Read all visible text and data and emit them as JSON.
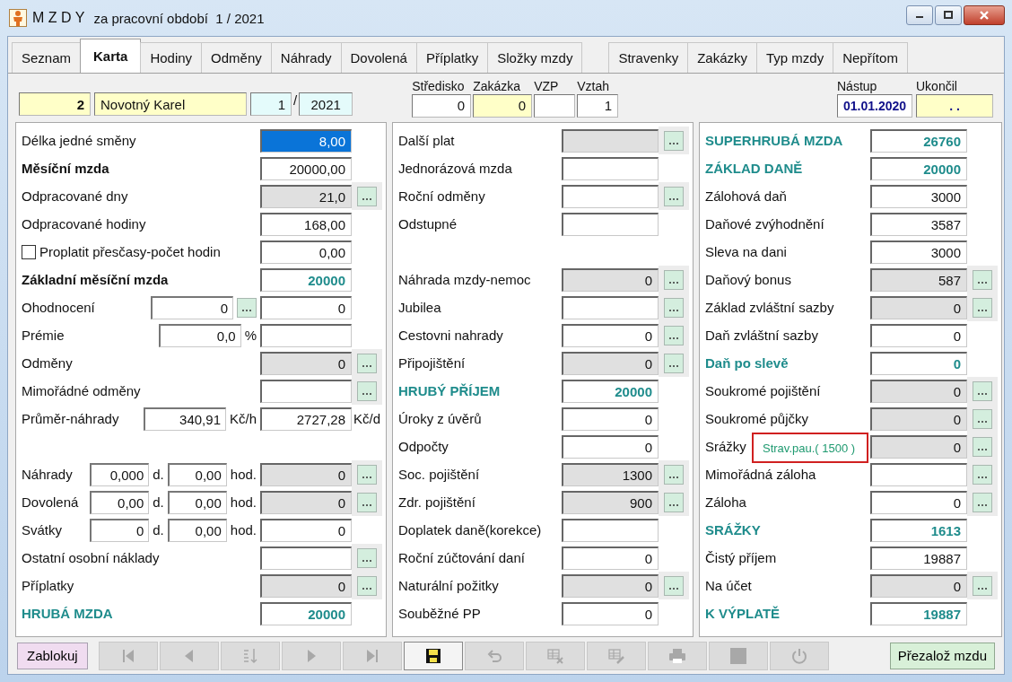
{
  "window": {
    "title": "M Z D Y",
    "subtitle": "za pracovní období  1 / 2021"
  },
  "tabs": [
    {
      "label": "Seznam",
      "selected": false
    },
    {
      "label": "Karta",
      "selected": true
    },
    {
      "label": "Hodiny",
      "selected": false
    },
    {
      "label": "Odměny",
      "selected": false
    },
    {
      "label": "Náhrady",
      "selected": false
    },
    {
      "label": "Dovolená",
      "selected": false
    },
    {
      "label": "Příplatky",
      "selected": false
    },
    {
      "label": "Složky mzdy",
      "selected": false
    },
    {
      "label": "Stravenky",
      "selected": false
    },
    {
      "label": "Zakázky",
      "selected": false
    },
    {
      "label": "Typ mzdy",
      "selected": false
    },
    {
      "label": "Nepřítom",
      "selected": false
    }
  ],
  "header": {
    "number": "2",
    "name": "Novotný Karel",
    "month": "1",
    "separator": "/",
    "year": "2021",
    "fields": [
      {
        "label": "Středisko",
        "value": "0",
        "highlighted": false
      },
      {
        "label": "Zakázka",
        "value": "0",
        "highlighted": true
      },
      {
        "label": "VZP",
        "highlighted": false
      },
      {
        "label": "Vztah",
        "value": "1",
        "highlighted": false
      }
    ],
    "dates": [
      {
        "label": "Nástup",
        "value": "01.01.2020",
        "highlighted": false
      },
      {
        "label": "Ukončil",
        "value": ". .",
        "highlighted": true
      }
    ]
  },
  "panels": [
    {
      "rows": [
        {
          "kind": "field",
          "label": "Délka jedné směny",
          "bold": false,
          "teal_label": false,
          "teal_value": false,
          "value": "8,00",
          "readonly": false,
          "more": false,
          "focused": true
        },
        {
          "kind": "field",
          "label": "Měsíční mzda",
          "bold": true,
          "teal_label": false,
          "teal_value": false,
          "value": "20000,00",
          "readonly": false,
          "more": false,
          "focused": false
        },
        {
          "kind": "field",
          "label": "Odpracované dny",
          "bold": false,
          "teal_label": false,
          "teal_value": false,
          "value": "21,0",
          "readonly": true,
          "more": true,
          "focused": false
        },
        {
          "kind": "field",
          "label": "Odpracované hodiny",
          "bold": false,
          "teal_label": false,
          "teal_value": false,
          "value": "168,00",
          "readonly": false,
          "more": false,
          "focused": false
        },
        {
          "kind": "check",
          "label": "Proplatit přesčasy-počet hodin",
          "checked": false,
          "bold": false,
          "teal_label": false,
          "teal_value": false,
          "value": "0,00",
          "readonly": false,
          "more": false,
          "focused": false
        },
        {
          "kind": "field",
          "label": "Základní měsíční mzda",
          "bold": true,
          "teal_label": false,
          "teal_value": true,
          "value": "20000",
          "readonly": false,
          "more": false,
          "focused": false
        },
        {
          "kind": "field",
          "label": "Ohodnocení",
          "bold": false,
          "teal_label": false,
          "teal_value": false,
          "inputs": [
            {
              "value": "0",
              "more": true
            }
          ],
          "value": "0",
          "readonly": false,
          "more": false,
          "focused": false
        },
        {
          "kind": "field",
          "label": "Prémie",
          "bold": false,
          "teal_label": false,
          "inputs": [
            {
              "value": "0,0",
              "unit": "%",
              "more": false
            }
          ],
          "readonly": false,
          "more": false,
          "focused": false
        },
        {
          "kind": "field",
          "label": "Odměny",
          "bold": false,
          "teal_label": false,
          "teal_value": false,
          "value": "0",
          "readonly": true,
          "more": true,
          "focused": false
        },
        {
          "kind": "field",
          "label": "Mimořádné odměny",
          "bold": false,
          "teal_label": false,
          "readonly": false,
          "more": true,
          "focused": false
        },
        {
          "kind": "field",
          "label": "Průměr-náhrady",
          "bold": false,
          "teal_label": false,
          "teal_value": false,
          "inputs": [
            {
              "value": "340,91",
              "unit": "Kč/h",
              "more": false
            }
          ],
          "value": "2727,28",
          "unit": "Kč/d",
          "readonly": false,
          "more": false,
          "focused": false
        },
        {
          "kind": "spacer"
        },
        {
          "kind": "field",
          "label": "Náhrady",
          "bold": false,
          "teal_label": false,
          "teal_value": false,
          "inputs": [
            {
              "value": "0,000",
              "unit": "d.",
              "more": false
            },
            {
              "value": "0,00",
              "unit": "hod.",
              "more": false
            }
          ],
          "value": "0",
          "readonly": true,
          "more": true,
          "focused": false
        },
        {
          "kind": "field",
          "label": "Dovolená",
          "bold": false,
          "teal_label": false,
          "teal_value": false,
          "inputs": [
            {
              "value": "0,00",
              "unit": "d.",
              "more": false
            },
            {
              "value": "0,00",
              "unit": "hod.",
              "more": false
            }
          ],
          "value": "0",
          "readonly": true,
          "more": true,
          "focused": false
        },
        {
          "kind": "field",
          "label": "Svátky",
          "bold": false,
          "teal_label": false,
          "teal_value": false,
          "inputs": [
            {
              "value": "0",
              "unit": "d.",
              "more": false
            },
            {
              "value": "0,00",
              "unit": "hod.",
              "more": false
            }
          ],
          "value": "0",
          "readonly": false,
          "more": false,
          "focused": false
        },
        {
          "kind": "field",
          "label": "Ostatní osobní náklady",
          "bold": false,
          "teal_label": false,
          "readonly": false,
          "more": true,
          "focused": false
        },
        {
          "kind": "field",
          "label": "Příplatky",
          "bold": false,
          "teal_label": false,
          "teal_value": false,
          "value": "0",
          "readonly": true,
          "more": true,
          "focused": false
        },
        {
          "kind": "field",
          "label": "HRUBÁ MZDA",
          "bold": true,
          "teal_label": true,
          "teal_value": true,
          "value": "20000",
          "readonly": false,
          "more": false,
          "focused": false
        }
      ]
    },
    {
      "rows": [
        {
          "kind": "field",
          "label": "Další plat",
          "bold": false,
          "teal_label": false,
          "readonly": true,
          "more": true,
          "focused": false
        },
        {
          "kind": "field",
          "label": "Jednorázová mzda",
          "bold": false,
          "teal_label": false,
          "readonly": false,
          "more": false,
          "focused": false
        },
        {
          "kind": "field",
          "label": "Roční odměny",
          "bold": false,
          "teal_label": false,
          "readonly": false,
          "more": true,
          "focused": false
        },
        {
          "kind": "field",
          "label": "Odstupné",
          "bold": false,
          "teal_label": false,
          "readonly": false,
          "more": false,
          "focused": false
        },
        {
          "kind": "spacer"
        },
        {
          "kind": "field",
          "label": "Náhrada mzdy-nemoc",
          "bold": false,
          "teal_label": false,
          "teal_value": false,
          "value": "0",
          "readonly": true,
          "more": true,
          "focused": false
        },
        {
          "kind": "field",
          "label": "Jubilea",
          "bold": false,
          "teal_label": false,
          "readonly": false,
          "more": true,
          "focused": false
        },
        {
          "kind": "field",
          "label": "Cestovni nahrady",
          "bold": false,
          "teal_label": false,
          "teal_value": false,
          "value": "0",
          "readonly": false,
          "more": true,
          "focused": false
        },
        {
          "kind": "field",
          "label": "Připojištění",
          "bold": false,
          "teal_label": false,
          "teal_value": false,
          "value": "0",
          "readonly": true,
          "more": true,
          "focused": false
        },
        {
          "kind": "field",
          "label": "HRUBÝ PŘÍJEM",
          "bold": true,
          "teal_label": true,
          "teal_value": true,
          "value": "20000",
          "readonly": false,
          "more": false,
          "focused": false
        },
        {
          "kind": "field",
          "label": "Úroky z úvěrů",
          "bold": false,
          "teal_label": false,
          "teal_value": false,
          "value": "0",
          "readonly": false,
          "more": false,
          "focused": false
        },
        {
          "kind": "field",
          "label": "Odpočty",
          "bold": false,
          "teal_label": false,
          "teal_value": false,
          "value": "0",
          "readonly": false,
          "more": false,
          "focused": false
        },
        {
          "kind": "field",
          "label": "Soc. pojištění",
          "bold": false,
          "teal_label": false,
          "teal_value": false,
          "value": "1300",
          "readonly": true,
          "more": true,
          "focused": false
        },
        {
          "kind": "field",
          "label": "Zdr. pojištění",
          "bold": false,
          "teal_label": false,
          "teal_value": false,
          "value": "900",
          "readonly": true,
          "more": true,
          "focused": false
        },
        {
          "kind": "field",
          "label": "Doplatek daně(korekce)",
          "bold": false,
          "teal_label": false,
          "readonly": false,
          "more": false,
          "focused": false
        },
        {
          "kind": "field",
          "label": "Roční zúčtování daní",
          "bold": false,
          "teal_label": false,
          "teal_value": false,
          "value": "0",
          "readonly": false,
          "more": false,
          "focused": false
        },
        {
          "kind": "field",
          "label": "Naturální požitky",
          "bold": false,
          "teal_label": false,
          "teal_value": false,
          "value": "0",
          "readonly": true,
          "more": true,
          "focused": false
        },
        {
          "kind": "field",
          "label": "Souběžné PP",
          "bold": false,
          "teal_label": false,
          "teal_value": false,
          "value": "0",
          "readonly": false,
          "more": false,
          "focused": false
        }
      ]
    },
    {
      "rows": [
        {
          "kind": "field",
          "label": "SUPERHRUBÁ MZDA",
          "bold": true,
          "teal_label": true,
          "teal_value": true,
          "value": "26760",
          "readonly": false,
          "more": false,
          "focused": false
        },
        {
          "kind": "field",
          "label": "ZÁKLAD DANĚ",
          "bold": true,
          "teal_label": true,
          "teal_value": true,
          "value": "20000",
          "readonly": false,
          "more": false,
          "focused": false
        },
        {
          "kind": "field",
          "label": "Zálohová daň",
          "bold": false,
          "teal_label": false,
          "teal_value": false,
          "value": "3000",
          "readonly": false,
          "more": false,
          "focused": false
        },
        {
          "kind": "field",
          "label": "Daňové zvýhodnění",
          "bold": false,
          "teal_label": false,
          "teal_value": false,
          "value": "3587",
          "readonly": false,
          "more": false,
          "focused": false
        },
        {
          "kind": "field",
          "label": "Sleva na dani",
          "bold": false,
          "teal_label": false,
          "teal_value": false,
          "value": "3000",
          "readonly": false,
          "more": false,
          "focused": false
        },
        {
          "kind": "field",
          "label": "Daňový bonus",
          "bold": false,
          "teal_label": false,
          "teal_value": false,
          "value": "587",
          "readonly": true,
          "more": true,
          "focused": false
        },
        {
          "kind": "field",
          "label": "Základ zvláštní sazby",
          "bold": false,
          "teal_label": false,
          "teal_value": false,
          "value": "0",
          "readonly": true,
          "more": true,
          "focused": false
        },
        {
          "kind": "field",
          "label": "Daň zvláštní sazby",
          "bold": false,
          "teal_label": false,
          "teal_value": false,
          "value": "0",
          "readonly": false,
          "more": false,
          "focused": false
        },
        {
          "kind": "field",
          "label": "Daň po slevě",
          "bold": true,
          "teal_label": true,
          "teal_value": true,
          "value": "0",
          "readonly": false,
          "more": false,
          "focused": false
        },
        {
          "kind": "field",
          "label": "Soukromé pojištění",
          "bold": false,
          "teal_label": false,
          "teal_value": false,
          "value": "0",
          "readonly": true,
          "more": true,
          "focused": false
        },
        {
          "kind": "field",
          "label": "Soukromé půjčky",
          "bold": false,
          "teal_label": false,
          "teal_value": false,
          "value": "0",
          "readonly": true,
          "more": true,
          "focused": false
        },
        {
          "kind": "field",
          "label": "Srážky",
          "bold": false,
          "teal_label": false,
          "teal_value": false,
          "value": "0",
          "readonly": true,
          "more": true,
          "focused": false,
          "tooltip": "Strav.pau.( 1500 )"
        },
        {
          "kind": "field",
          "label": "Mimořádná záloha",
          "bold": false,
          "teal_label": false,
          "readonly": false,
          "more": true,
          "focused": false
        },
        {
          "kind": "field",
          "label": "Záloha",
          "bold": false,
          "teal_label": false,
          "teal_value": false,
          "value": "0",
          "readonly": false,
          "more": true,
          "focused": false
        },
        {
          "kind": "field",
          "label": "SRÁŽKY",
          "bold": true,
          "teal_label": true,
          "teal_value": true,
          "value": "1613",
          "readonly": false,
          "more": false,
          "focused": false
        },
        {
          "kind": "field",
          "label": "Čistý příjem",
          "bold": false,
          "teal_label": false,
          "teal_value": false,
          "value": "19887",
          "readonly": false,
          "more": false,
          "focused": false
        },
        {
          "kind": "field",
          "label": "Na účet",
          "bold": false,
          "teal_label": false,
          "teal_value": false,
          "value": "0",
          "readonly": true,
          "more": true,
          "focused": false
        },
        {
          "kind": "field",
          "label": "K VÝPLATĚ",
          "bold": true,
          "teal_label": true,
          "teal_value": true,
          "value": "19887",
          "readonly": false,
          "more": false,
          "focused": false
        }
      ]
    }
  ],
  "toolbar": {
    "lock_button": "Zablokuj",
    "rebuild_button": "Přezalož mzdu",
    "tools": [
      {
        "kind": "first",
        "disabled": true
      },
      {
        "kind": "prev",
        "disabled": true
      },
      {
        "kind": "sort",
        "disabled": true
      },
      {
        "kind": "next",
        "disabled": true
      },
      {
        "kind": "last",
        "disabled": true
      },
      {
        "kind": "save",
        "disabled": false
      },
      {
        "kind": "undo",
        "disabled": true
      },
      {
        "kind": "delete",
        "disabled": true
      },
      {
        "kind": "edit",
        "disabled": true
      },
      {
        "kind": "print",
        "disabled": true
      },
      {
        "kind": "stop",
        "disabled": true
      },
      {
        "kind": "power",
        "disabled": true
      }
    ]
  }
}
